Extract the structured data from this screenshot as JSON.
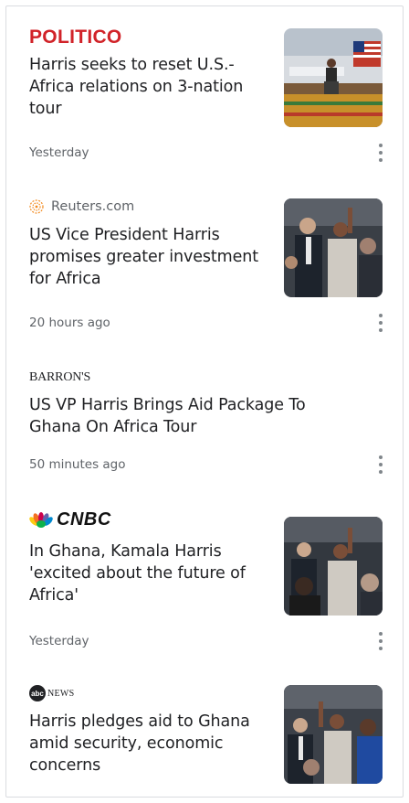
{
  "articles": [
    {
      "source": "POLITICO",
      "headline": "Harris seeks to reset U.S.-Africa relations on 3-nation tour",
      "time": "Yesterday",
      "thumbnail": "harris-podium-airport-photo"
    },
    {
      "source": "Reuters.com",
      "headline": "US Vice President Harris promises greater investment for Africa",
      "time": "20 hours ago",
      "thumbnail": "harris-waving-crowd-photo"
    },
    {
      "source": "BARRON'S",
      "headline": "US VP Harris Brings Aid Package To Ghana On Africa Tour",
      "time": "50 minutes ago"
    },
    {
      "source": "CNBC",
      "headline": "In Ghana, Kamala Harris 'excited about the future of Africa'",
      "time": "Yesterday",
      "thumbnail": "harris-waving-crowd-photo"
    },
    {
      "source": "NEWS",
      "source_logo_text": "abc",
      "headline": "Harris pledges aid to Ghana amid security, economic concerns",
      "time": "",
      "thumbnail": "harris-waving-crowd-photo"
    }
  ],
  "colors": {
    "politico_red": "#d12329",
    "text_primary": "#202124",
    "text_secondary": "#5f6368",
    "border": "#dadce0"
  }
}
